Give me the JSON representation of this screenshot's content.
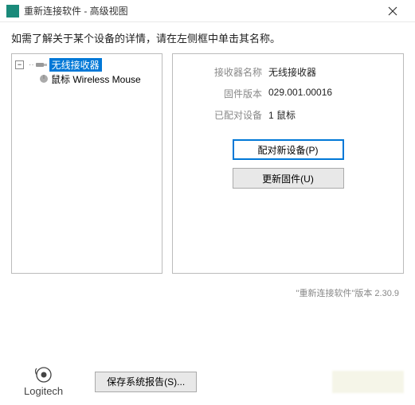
{
  "titlebar": {
    "title": "重新连接软件 - 高级视图"
  },
  "instruction": "如需了解关于某个设备的详情，请在左侧框中单击其名称。",
  "tree": {
    "root": {
      "label": "无线接收器"
    },
    "child": {
      "label": "鼠标 Wireless Mouse"
    }
  },
  "detail": {
    "rows": [
      {
        "label": "接收器名称",
        "value": "无线接收器"
      },
      {
        "label": "固件版本",
        "value": "029.001.00016"
      },
      {
        "label": "已配对设备",
        "value": "1 鼠标"
      }
    ],
    "pair_btn": "配对新设备(P)",
    "update_btn": "更新固件(U)"
  },
  "version": "\"重新连接软件\"版本 2.30.9",
  "footer": {
    "logo": "Logitech",
    "save_report": "保存系统报告(S)..."
  }
}
